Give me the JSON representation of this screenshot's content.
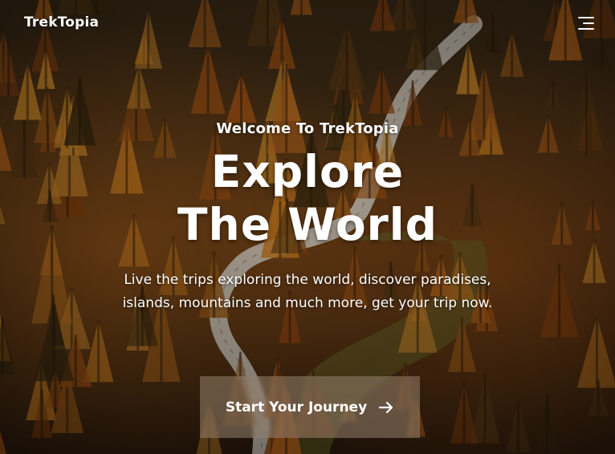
{
  "brand": {
    "name": "TrekTopia"
  },
  "nav": {
    "menu_icon": "hamburger-menu-icon"
  },
  "hero": {
    "welcome": "Welcome To TrekTopia",
    "headline_line1": "Explore",
    "headline_line2": "The World",
    "subtitle": "Live the trips exploring the world, discover paradises, islands, mountains and much more, get your trip now.",
    "cta_label": "Start Your Journey",
    "cta_icon": "arrow-right-icon"
  },
  "colors": {
    "text": "#ffffff",
    "forest_orange": "#b8651c",
    "forest_dark": "#1b120a",
    "road": "#d9d4c8",
    "cta_bg": "rgba(150,130,110,0.55)"
  }
}
